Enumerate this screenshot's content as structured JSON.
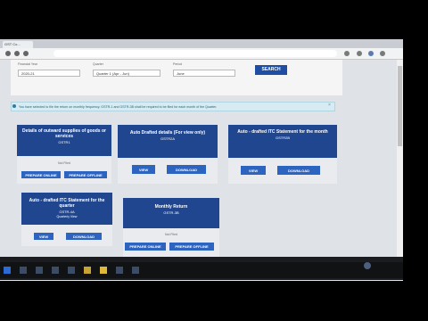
{
  "browser": {
    "tab_title": "GST Co...",
    "menu_icons": [
      "star-icon",
      "extension-icon",
      "profile-icon",
      "menu-icon"
    ]
  },
  "filters": {
    "financial_year": {
      "label": "Financial Year",
      "value": "2020-21"
    },
    "quarter": {
      "label": "Quarter",
      "value": "Quarter 1 (Apr - Jun)"
    },
    "period": {
      "label": "Period",
      "value": "June"
    },
    "search_label": "SEARCH"
  },
  "info_message": "You have selected to file the return on monthly frequency. GSTR-1 and GSTR-3B shall be required to be filed for each month of the Quarter.",
  "cards": {
    "gstr1": {
      "title": "Details of outward supplies of goods or services",
      "code": "GSTR1",
      "status": "Not Filed",
      "prepare_online": "PREPARE ONLINE",
      "prepare_offline": "PREPARE OFFLINE"
    },
    "gstr2a": {
      "title": "Auto Drafted details (For view only)",
      "code": "GSTR2A",
      "view": "VIEW",
      "download": "DOWNLOAD"
    },
    "gstr2b": {
      "title": "Auto - drafted ITC Statement for the month",
      "code": "GSTR2B",
      "view": "VIEW",
      "download": "DOWNLOAD"
    },
    "gstr4a": {
      "title": "Auto - drafted ITC Statement for the quarter",
      "code": "GSTR-4A",
      "sub": "Quarterly View",
      "view": "VIEW",
      "download": "DOWNLOAD"
    },
    "gstr3b": {
      "title": "Monthly Return",
      "code": "GSTR-3B",
      "status": "Not Filed",
      "prepare_online": "PREPARE ONLINE",
      "prepare_offline": "PREPARE OFFLINE"
    }
  },
  "colors": {
    "card_header": "#20468f",
    "button": "#2d64bf",
    "info_bg": "#d7ebf2"
  }
}
